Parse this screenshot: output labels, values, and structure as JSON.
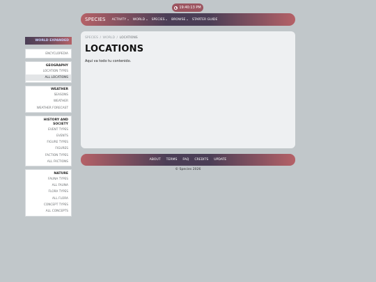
{
  "clock": {
    "time": "19:40:13 PM"
  },
  "topnav": {
    "brand": "SPECIES",
    "items": [
      {
        "label": "ACTIVITY",
        "dropdown": true
      },
      {
        "label": "WORLD",
        "dropdown": true
      },
      {
        "label": "SPECIES",
        "dropdown": true
      },
      {
        "label": "BROWSE",
        "dropdown": true
      },
      {
        "label": "STARTER GUIDE",
        "dropdown": false
      }
    ]
  },
  "sidebar": {
    "header": "WORLD EXPANDED",
    "sections": [
      {
        "title": "",
        "items": [
          "ENCYCLOPEDIA"
        ]
      },
      {
        "title": "GEOGRAPHY",
        "items": [
          "LOCATION TYPES",
          "ALL LOCATIONS"
        ]
      },
      {
        "title": "WEATHER",
        "items": [
          "SEASONS",
          "WEATHER",
          "WEATHER FORECAST"
        ]
      },
      {
        "title": "HISTORY AND SOCIETY",
        "items": [
          "EVENT TYPES",
          "EVENTS",
          "FIGURE TYPES",
          "FIGURES",
          "FACTION TYPES",
          "ALL FACTIONS"
        ]
      },
      {
        "title": "NATURE",
        "items": [
          "FAUNA TYPES",
          "ALL FAUNA",
          "FLORA TYPES",
          "ALL FLORA",
          "CONCEPT TYPES",
          "ALL CONCEPTS"
        ]
      }
    ],
    "active_item": "ALL LOCATIONS"
  },
  "main": {
    "breadcrumb": [
      "SPECIES",
      "WORLD",
      "LOCATIONS"
    ],
    "breadcrumb_sep": "/",
    "title": "LOCATIONS",
    "body_text": "Aqui va todo tu contenido."
  },
  "footer": {
    "links": [
      "ABOUT",
      "TERMS",
      "FAQ",
      "CREDITS",
      "UPDATE"
    ],
    "copyright": "© Species 2026"
  },
  "colors": {
    "background": "#c1c7ca",
    "accent_rose": "#b56167",
    "accent_plum": "#4b3e56",
    "panel": "#eef0f2"
  }
}
